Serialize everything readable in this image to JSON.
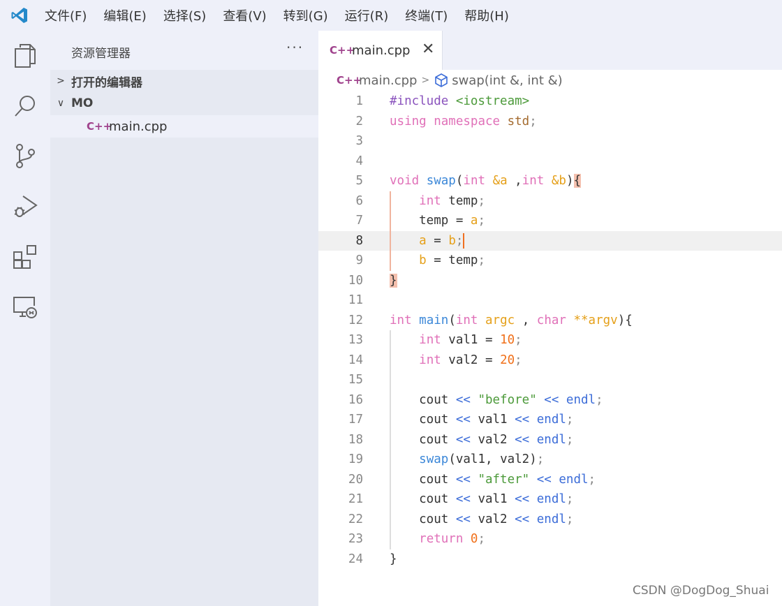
{
  "app": {
    "logo_icon": "vscode-logo-icon"
  },
  "menu": [
    "文件(F)",
    "编辑(E)",
    "选择(S)",
    "查看(V)",
    "转到(G)",
    "运行(R)",
    "终端(T)",
    "帮助(H)"
  ],
  "activity_bar": [
    {
      "icon": "files-icon"
    },
    {
      "icon": "search-icon"
    },
    {
      "icon": "source-control-icon"
    },
    {
      "icon": "run-debug-icon"
    },
    {
      "icon": "extensions-icon"
    },
    {
      "icon": "remote-explorer-icon"
    }
  ],
  "sidebar": {
    "title": "资源管理器",
    "more": "···",
    "open_editors": "打开的编辑器",
    "folder": "MO",
    "file_icon": "C++",
    "file": "main.cpp"
  },
  "editor": {
    "tab": {
      "icon": "C++",
      "label": "main.cpp",
      "close": "✕"
    },
    "breadcrumb": {
      "file": "main.cpp",
      "symbol": "swap(int &, int &)"
    },
    "current_line": 8,
    "lines": [
      [
        {
          "t": "#include ",
          "c": "pp"
        },
        {
          "t": "<iostream>",
          "c": "inc"
        }
      ],
      [
        {
          "t": "using",
          "c": "kw"
        },
        {
          "t": " "
        },
        {
          "t": "namespace",
          "c": "kw"
        },
        {
          "t": " "
        },
        {
          "t": "std",
          "c": "ns"
        },
        {
          "t": ";",
          "c": "pt"
        }
      ],
      [],
      [],
      [
        {
          "t": "void",
          "c": "kw"
        },
        {
          "t": " "
        },
        {
          "t": "swap",
          "c": "fn"
        },
        {
          "t": "("
        },
        {
          "t": "int",
          "c": "kw"
        },
        {
          "t": " "
        },
        {
          "t": "&a",
          "c": "var"
        },
        {
          "t": " ,"
        },
        {
          "t": "int",
          "c": "kw"
        },
        {
          "t": " "
        },
        {
          "t": "&b",
          "c": "var"
        },
        {
          "t": ")"
        },
        {
          "t": "{",
          "c": "brace-hl"
        }
      ],
      [
        {
          "t": "    "
        },
        {
          "t": "int",
          "c": "kw"
        },
        {
          "t": " temp"
        },
        {
          "t": ";",
          "c": "pt"
        }
      ],
      [
        {
          "t": "    temp = "
        },
        {
          "t": "a",
          "c": "var"
        },
        {
          "t": ";",
          "c": "pt"
        }
      ],
      [
        {
          "t": "    "
        },
        {
          "t": "a",
          "c": "var"
        },
        {
          "t": " = "
        },
        {
          "t": "b",
          "c": "var"
        },
        {
          "t": ";",
          "c": "pt"
        }
      ],
      [
        {
          "t": "    "
        },
        {
          "t": "b",
          "c": "var"
        },
        {
          "t": " = temp"
        },
        {
          "t": ";",
          "c": "pt"
        }
      ],
      [
        {
          "t": "}",
          "c": "brace-hl"
        }
      ],
      [],
      [
        {
          "t": "int",
          "c": "kw"
        },
        {
          "t": " "
        },
        {
          "t": "main",
          "c": "fn"
        },
        {
          "t": "("
        },
        {
          "t": "int",
          "c": "kw"
        },
        {
          "t": " "
        },
        {
          "t": "argc",
          "c": "var"
        },
        {
          "t": " , "
        },
        {
          "t": "char",
          "c": "kw"
        },
        {
          "t": " "
        },
        {
          "t": "**argv",
          "c": "var"
        },
        {
          "t": "){"
        }
      ],
      [
        {
          "t": "    "
        },
        {
          "t": "int",
          "c": "kw"
        },
        {
          "t": " val1 = "
        },
        {
          "t": "10",
          "c": "num"
        },
        {
          "t": ";",
          "c": "pt"
        }
      ],
      [
        {
          "t": "    "
        },
        {
          "t": "int",
          "c": "kw"
        },
        {
          "t": " val2 = "
        },
        {
          "t": "20",
          "c": "num"
        },
        {
          "t": ";",
          "c": "pt"
        }
      ],
      [],
      [
        {
          "t": "    cout "
        },
        {
          "t": "<<",
          "c": "op"
        },
        {
          "t": " "
        },
        {
          "t": "\"before\"",
          "c": "str"
        },
        {
          "t": " "
        },
        {
          "t": "<<",
          "c": "op"
        },
        {
          "t": " "
        },
        {
          "t": "endl",
          "c": "op"
        },
        {
          "t": ";",
          "c": "pt"
        }
      ],
      [
        {
          "t": "    cout "
        },
        {
          "t": "<<",
          "c": "op"
        },
        {
          "t": " val1 "
        },
        {
          "t": "<<",
          "c": "op"
        },
        {
          "t": " "
        },
        {
          "t": "endl",
          "c": "op"
        },
        {
          "t": ";",
          "c": "pt"
        }
      ],
      [
        {
          "t": "    cout "
        },
        {
          "t": "<<",
          "c": "op"
        },
        {
          "t": " val2 "
        },
        {
          "t": "<<",
          "c": "op"
        },
        {
          "t": " "
        },
        {
          "t": "endl",
          "c": "op"
        },
        {
          "t": ";",
          "c": "pt"
        }
      ],
      [
        {
          "t": "    "
        },
        {
          "t": "swap",
          "c": "fn"
        },
        {
          "t": "(val1, val2)"
        },
        {
          "t": ";",
          "c": "pt"
        }
      ],
      [
        {
          "t": "    cout "
        },
        {
          "t": "<<",
          "c": "op"
        },
        {
          "t": " "
        },
        {
          "t": "\"after\"",
          "c": "str"
        },
        {
          "t": " "
        },
        {
          "t": "<<",
          "c": "op"
        },
        {
          "t": " "
        },
        {
          "t": "endl",
          "c": "op"
        },
        {
          "t": ";",
          "c": "pt"
        }
      ],
      [
        {
          "t": "    cout "
        },
        {
          "t": "<<",
          "c": "op"
        },
        {
          "t": " val1 "
        },
        {
          "t": "<<",
          "c": "op"
        },
        {
          "t": " "
        },
        {
          "t": "endl",
          "c": "op"
        },
        {
          "t": ";",
          "c": "pt"
        }
      ],
      [
        {
          "t": "    cout "
        },
        {
          "t": "<<",
          "c": "op"
        },
        {
          "t": " val2 "
        },
        {
          "t": "<<",
          "c": "op"
        },
        {
          "t": " "
        },
        {
          "t": "endl",
          "c": "op"
        },
        {
          "t": ";",
          "c": "pt"
        }
      ],
      [
        {
          "t": "    "
        },
        {
          "t": "return",
          "c": "kw"
        },
        {
          "t": " "
        },
        {
          "t": "0",
          "c": "num"
        },
        {
          "t": ";",
          "c": "pt"
        }
      ],
      [
        {
          "t": "}"
        }
      ]
    ]
  },
  "watermark": "CSDN @DogDog_Shuai",
  "colors": {
    "chrome_bg": "#eef0f9",
    "sidebar_bg": "#e6e9f2",
    "keyword": "#e070b8",
    "function": "#3b87d8",
    "variable": "#e5a01a",
    "number": "#f0701a",
    "string": "#4c9a3a",
    "cursor": "#f07020"
  }
}
